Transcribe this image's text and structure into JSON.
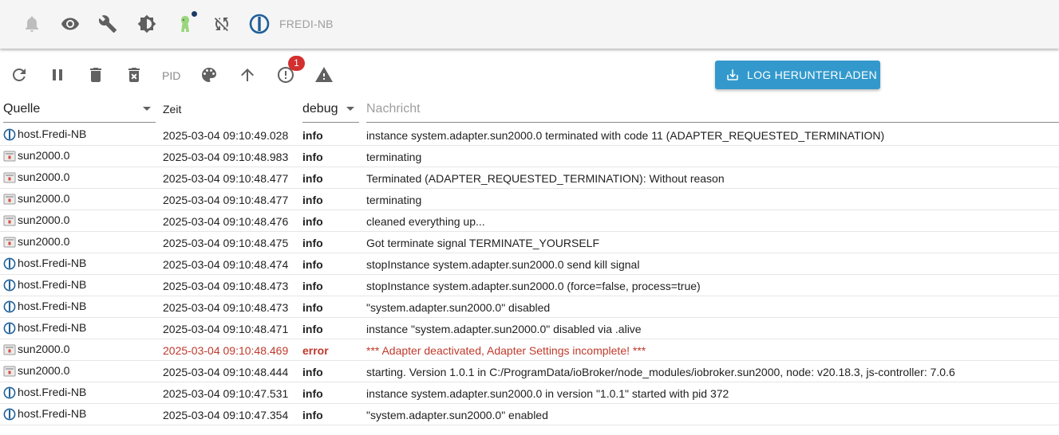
{
  "appbar": {
    "host_name": "FREDI-NB",
    "icons": [
      "bell-icon",
      "eye-icon",
      "wrench-icon",
      "brightness-icon",
      "person-icon",
      "sync-off-icon",
      "iobroker-logo"
    ]
  },
  "toolbar": {
    "pid_label": "PID",
    "warning_badge": "1",
    "download_label": "LOG HERUNTERLADEN",
    "accent_color": "#3399cc"
  },
  "filters": {
    "source_label": "Quelle",
    "time_label": "Zeit",
    "level_label": "debug",
    "message_placeholder": "Nachricht"
  },
  "log": [
    {
      "source": "host.Fredi-NB",
      "source_type": "host",
      "time": "2025-03-04 09:10:49.028",
      "severity": "info",
      "message": "instance system.adapter.sun2000.0 terminated with code 11 (ADAPTER_REQUESTED_TERMINATION)"
    },
    {
      "source": "sun2000.0",
      "source_type": "adapter",
      "time": "2025-03-04 09:10:48.983",
      "severity": "info",
      "message": "terminating"
    },
    {
      "source": "sun2000.0",
      "source_type": "adapter",
      "time": "2025-03-04 09:10:48.477",
      "severity": "info",
      "message": "Terminated (ADAPTER_REQUESTED_TERMINATION): Without reason"
    },
    {
      "source": "sun2000.0",
      "source_type": "adapter",
      "time": "2025-03-04 09:10:48.477",
      "severity": "info",
      "message": "terminating"
    },
    {
      "source": "sun2000.0",
      "source_type": "adapter",
      "time": "2025-03-04 09:10:48.476",
      "severity": "info",
      "message": "cleaned everything up..."
    },
    {
      "source": "sun2000.0",
      "source_type": "adapter",
      "time": "2025-03-04 09:10:48.475",
      "severity": "info",
      "message": "Got terminate signal TERMINATE_YOURSELF"
    },
    {
      "source": "host.Fredi-NB",
      "source_type": "host",
      "time": "2025-03-04 09:10:48.474",
      "severity": "info",
      "message": "stopInstance system.adapter.sun2000.0 send kill signal"
    },
    {
      "source": "host.Fredi-NB",
      "source_type": "host",
      "time": "2025-03-04 09:10:48.473",
      "severity": "info",
      "message": "stopInstance system.adapter.sun2000.0 (force=false, process=true)"
    },
    {
      "source": "host.Fredi-NB",
      "source_type": "host",
      "time": "2025-03-04 09:10:48.473",
      "severity": "info",
      "message": "\"system.adapter.sun2000.0\" disabled"
    },
    {
      "source": "host.Fredi-NB",
      "source_type": "host",
      "time": "2025-03-04 09:10:48.471",
      "severity": "info",
      "message": "instance \"system.adapter.sun2000.0\" disabled via .alive"
    },
    {
      "source": "sun2000.0",
      "source_type": "adapter",
      "time": "2025-03-04 09:10:48.469",
      "severity": "error",
      "message": "*** Adapter deactivated, Adapter Settings incomplete! ***"
    },
    {
      "source": "sun2000.0",
      "source_type": "adapter",
      "time": "2025-03-04 09:10:48.444",
      "severity": "info",
      "message": "starting. Version 1.0.1 in C:/ProgramData/ioBroker/node_modules/iobroker.sun2000, node: v20.18.3, js-controller: 7.0.6"
    },
    {
      "source": "host.Fredi-NB",
      "source_type": "host",
      "time": "2025-03-04 09:10:47.531",
      "severity": "info",
      "message": "instance system.adapter.sun2000.0 in version \"1.0.1\" started with pid 372"
    },
    {
      "source": "host.Fredi-NB",
      "source_type": "host",
      "time": "2025-03-04 09:10:47.354",
      "severity": "info",
      "message": "\"system.adapter.sun2000.0\" enabled"
    }
  ],
  "colors": {
    "error_text": "#c0392b",
    "host_icon": "#1f5f99",
    "badge": "#d32f2f"
  }
}
